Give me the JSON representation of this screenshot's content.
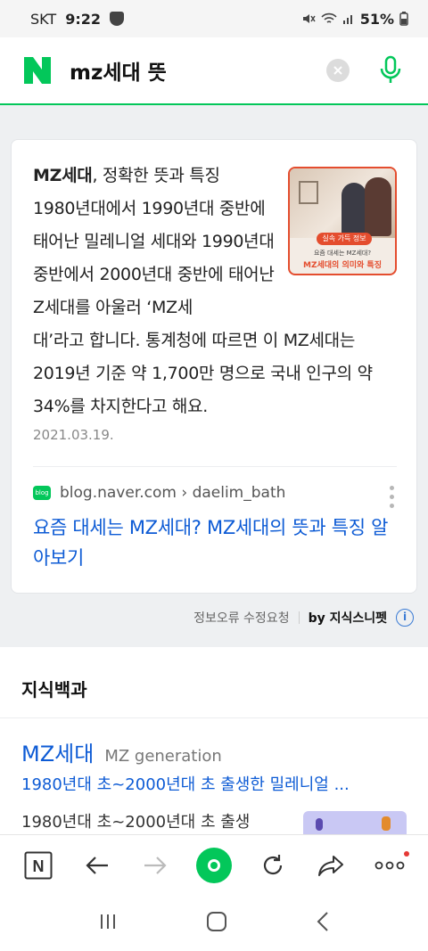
{
  "status_bar": {
    "carrier": "SKT",
    "time": "9:22",
    "battery": "51%"
  },
  "search": {
    "query": "mz세대 뜻"
  },
  "snippet": {
    "title": "MZ세대",
    "title_suffix": ", 정확한 뜻과 특징",
    "text_narrow": "1980년대에서 1990년대 중반에 태어난 밀레니얼 세대와 1990년대 중반에서 2000년대 중반에 태어난 Z세대를 아울러 ‘MZ세",
    "text_wide": "대’라고 합니다. 통계청에 따르면 이 MZ세대는 2019년 기준 약 1,700만 명으로 국내 인구의 약 34%를 차지한다고 해요.",
    "date": "2021.03.19.",
    "thumbnail": {
      "tag": "실속 가득 정보",
      "caption1": "요즘 대세는 MZ세대?",
      "caption2": "MZ세대의 의미와 특징"
    },
    "source_icon_label": "blog",
    "source": "blog.naver.com › daelim_bath",
    "link_title": "요즘 대세는 MZ세대? MZ세대의 뜻과 특징 알아보기"
  },
  "report": {
    "report_label": "정보오류 수정요청",
    "by_label": "by 지식스니펫",
    "info_icon": "i"
  },
  "knowledge": {
    "section_title": "지식백과",
    "entry_name": "MZ세대",
    "entry_english": "MZ generation",
    "entry_subtitle": "1980년대 초~2000년대 초 출생한 밀레니얼 ...",
    "entry_desc": "1980년대 초~2000년대 초 출생"
  },
  "toolbar": {
    "naver_label": "N"
  },
  "colors": {
    "naver_green": "#03c75a",
    "link_blue": "#0d5bd5",
    "thumb_accent": "#e44d2e"
  },
  "icons": [
    "naver-logo-icon",
    "clear-icon",
    "mic-icon",
    "naver-tab-icon",
    "back-icon",
    "forward-icon",
    "home-icon",
    "refresh-icon",
    "share-icon",
    "more-icon",
    "recent-apps-icon",
    "home-nav-icon",
    "back-nav-icon"
  ]
}
